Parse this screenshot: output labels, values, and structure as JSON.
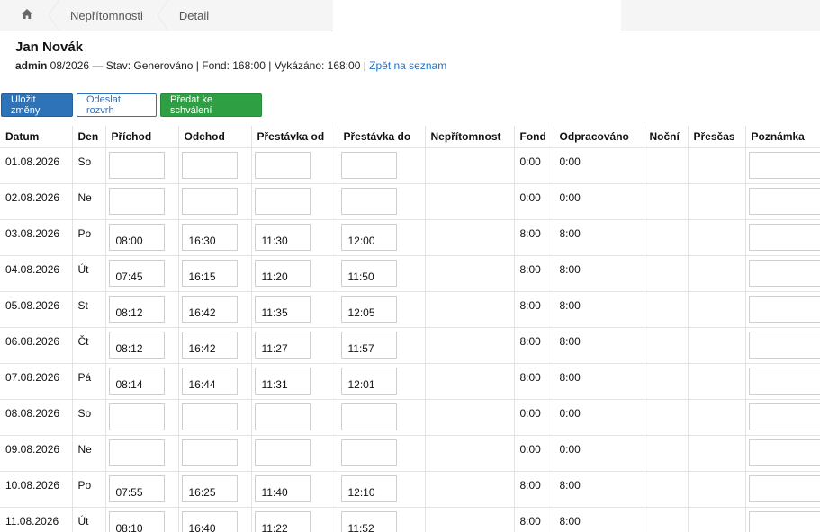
{
  "breadcrumb": {
    "home_icon": "home-icon",
    "items": [
      "Nepřítomnosti",
      "Detail"
    ]
  },
  "header": {
    "name": "Jan Novák",
    "user": "admin",
    "info": " 08/2026 — Stav: Generováno | Fond: 168:00 | Vykázáno: 168:00 | ",
    "back_link": "Zpět na seznam"
  },
  "toolbar": {
    "save": "Uložit změny",
    "send": "Odeslat rozvrh",
    "approve": "Předat ke schválení"
  },
  "colors": {
    "blue": "#2e73b8",
    "green": "#2ea043",
    "link": "#1f74c9"
  },
  "table": {
    "columns": [
      "Datum",
      "Den",
      "Příchod",
      "Odchod",
      "Přestávka od",
      "Přestávka do",
      "Nepřítomnost",
      "Fond",
      "Odpracováno",
      "Noční",
      "Přesčas",
      "Poznámka"
    ],
    "rows": [
      {
        "date": "01.08.2026",
        "day": "So",
        "in": "",
        "out": "",
        "bfrom": "",
        "bto": "",
        "absence": "",
        "fond": "0:00",
        "worked": "0:00",
        "night": "",
        "overtime": "",
        "note": ""
      },
      {
        "date": "02.08.2026",
        "day": "Ne",
        "in": "",
        "out": "",
        "bfrom": "",
        "bto": "",
        "absence": "",
        "fond": "0:00",
        "worked": "0:00",
        "night": "",
        "overtime": "",
        "note": ""
      },
      {
        "date": "03.08.2026",
        "day": "Po",
        "in": "08:00",
        "out": "16:30",
        "bfrom": "11:30",
        "bto": "12:00",
        "absence": "",
        "fond": "8:00",
        "worked": "8:00",
        "night": "",
        "overtime": "",
        "note": ""
      },
      {
        "date": "04.08.2026",
        "day": "Út",
        "in": "07:45",
        "out": "16:15",
        "bfrom": "11:20",
        "bto": "11:50",
        "absence": "",
        "fond": "8:00",
        "worked": "8:00",
        "night": "",
        "overtime": "",
        "note": ""
      },
      {
        "date": "05.08.2026",
        "day": "St",
        "in": "08:12",
        "out": "16:42",
        "bfrom": "11:35",
        "bto": "12:05",
        "absence": "",
        "fond": "8:00",
        "worked": "8:00",
        "night": "",
        "overtime": "",
        "note": ""
      },
      {
        "date": "06.08.2026",
        "day": "Čt",
        "in": "08:12",
        "out": "16:42",
        "bfrom": "11:27",
        "bto": "11:57",
        "absence": "",
        "fond": "8:00",
        "worked": "8:00",
        "night": "",
        "overtime": "",
        "note": ""
      },
      {
        "date": "07.08.2026",
        "day": "Pá",
        "in": "08:14",
        "out": "16:44",
        "bfrom": "11:31",
        "bto": "12:01",
        "absence": "",
        "fond": "8:00",
        "worked": "8:00",
        "night": "",
        "overtime": "",
        "note": ""
      },
      {
        "date": "08.08.2026",
        "day": "So",
        "in": "",
        "out": "",
        "bfrom": "",
        "bto": "",
        "absence": "",
        "fond": "0:00",
        "worked": "0:00",
        "night": "",
        "overtime": "",
        "note": ""
      },
      {
        "date": "09.08.2026",
        "day": "Ne",
        "in": "",
        "out": "",
        "bfrom": "",
        "bto": "",
        "absence": "",
        "fond": "0:00",
        "worked": "0:00",
        "night": "",
        "overtime": "",
        "note": ""
      },
      {
        "date": "10.08.2026",
        "day": "Po",
        "in": "07:55",
        "out": "16:25",
        "bfrom": "11:40",
        "bto": "12:10",
        "absence": "",
        "fond": "8:00",
        "worked": "8:00",
        "night": "",
        "overtime": "",
        "note": ""
      },
      {
        "date": "11.08.2026",
        "day": "Út",
        "in": "08:10",
        "out": "16:40",
        "bfrom": "11:22",
        "bto": "11:52",
        "absence": "",
        "fond": "8:00",
        "worked": "8:00",
        "night": "",
        "overtime": "",
        "note": ""
      }
    ]
  }
}
